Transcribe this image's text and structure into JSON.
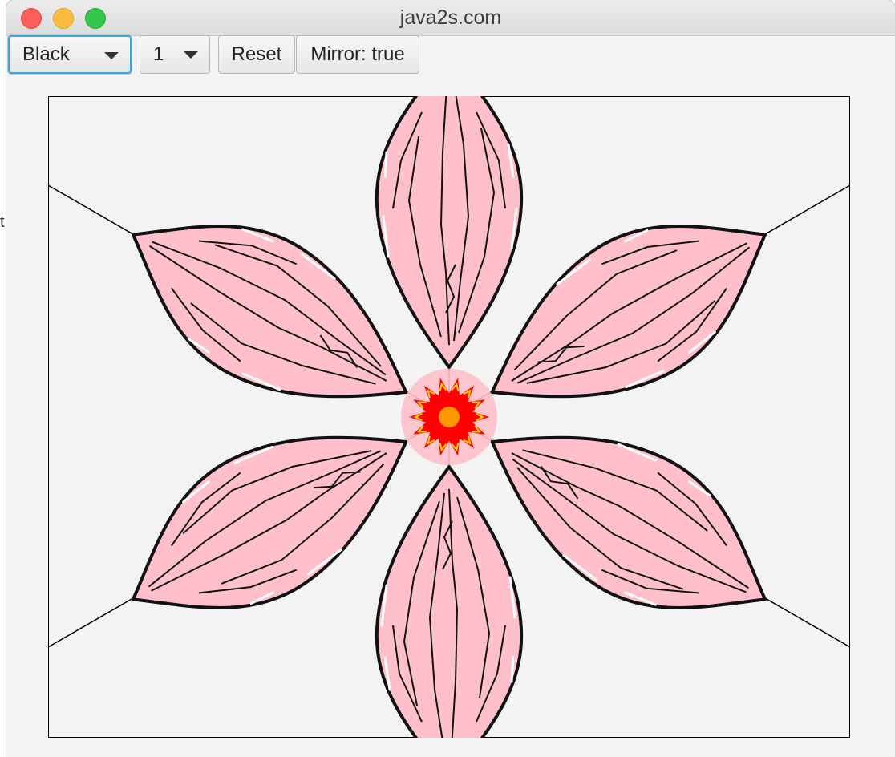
{
  "window": {
    "title": "java2s.com"
  },
  "stray_text": "t",
  "toolbar": {
    "color_select": {
      "value": "Black"
    },
    "width_select": {
      "value": "1"
    },
    "reset_label": "Reset",
    "mirror_label": "Mirror: true"
  },
  "canvas": {
    "guide_line_color": "#000000",
    "petal_fill": "#ffc0cb",
    "petal_outline": "#111111",
    "petal_highlight": "#ffffff",
    "center_star_color": "#ff0000",
    "center_star_accent": "#ffd700",
    "center_dot_color": "#ff9900",
    "petal_count": 6
  }
}
